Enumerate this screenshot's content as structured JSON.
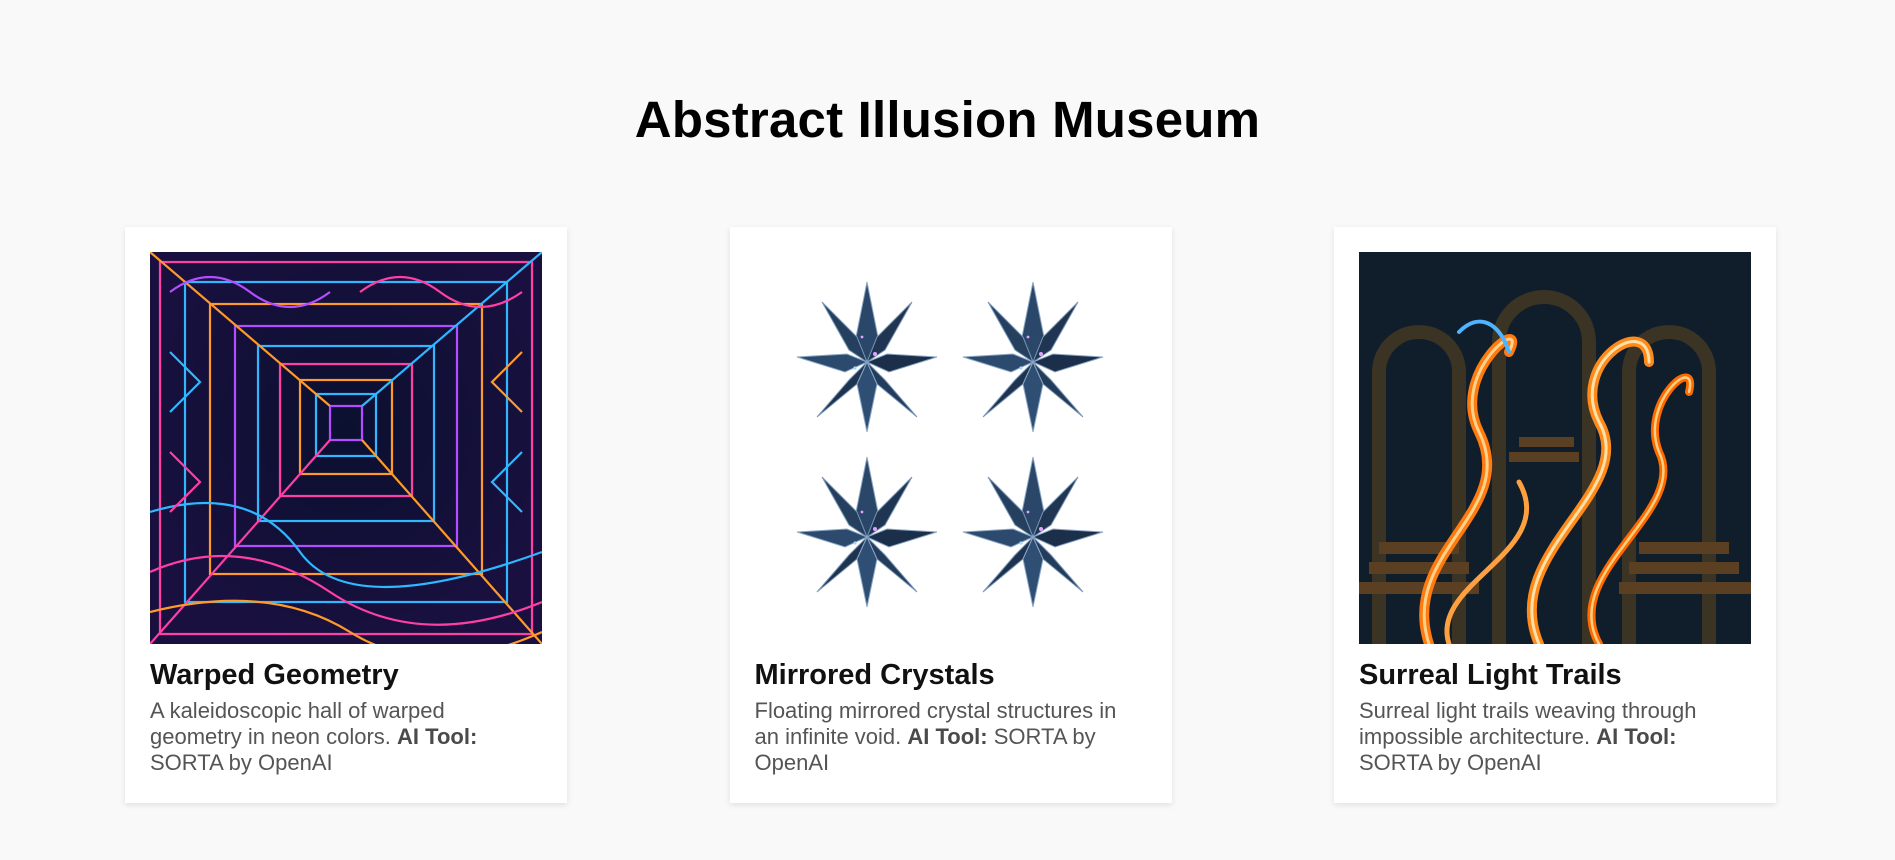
{
  "page": {
    "title": "Abstract Illusion Museum"
  },
  "artworks": [
    {
      "title": "Warped Geometry",
      "description": "A kaleidoscopic hall of warped geometry in neon colors.",
      "tool_label": "AI Tool:",
      "tool_value": "SORTA by OpenAI",
      "image_icon": "warped-geometry-artwork"
    },
    {
      "title": "Mirrored Crystals",
      "description": "Floating mirrored crystal structures in an infinite void.",
      "tool_label": "AI Tool:",
      "tool_value": "SORTA by OpenAI",
      "image_icon": "mirrored-crystals-artwork"
    },
    {
      "title": "Surreal Light Trails",
      "description": "Surreal light trails weaving through impossible architecture.",
      "tool_label": "AI Tool:",
      "tool_value": "SORTA by OpenAI",
      "image_icon": "surreal-light-trails-artwork"
    }
  ],
  "colors": {
    "background": "#f9f9f9",
    "card": "#ffffff",
    "neon_pink": "#ff3fa4",
    "neon_blue": "#2fb7ff",
    "neon_orange": "#ff9a2a",
    "crystal_dark": "#1f3552",
    "light_trail": "#ff8a1c"
  }
}
